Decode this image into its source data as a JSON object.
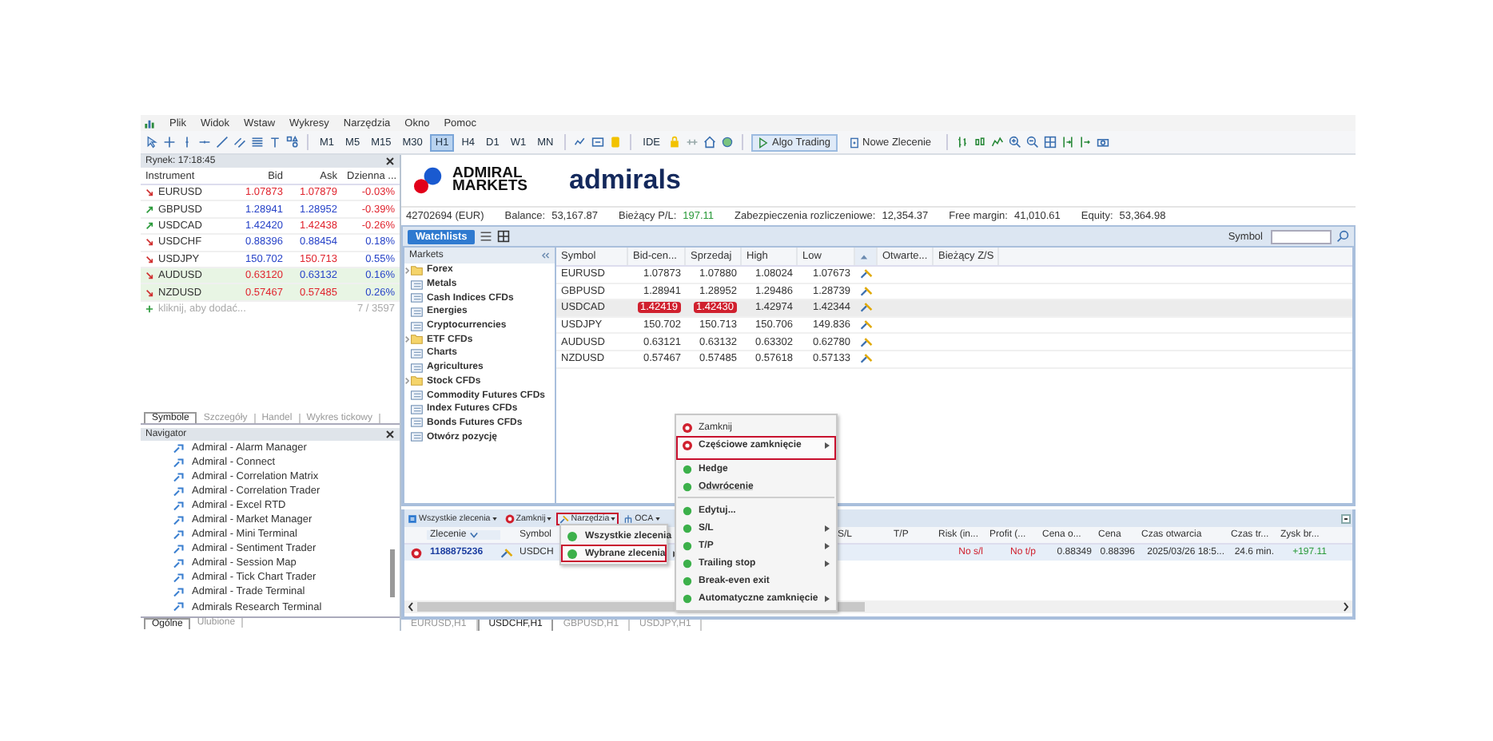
{
  "menu": [
    "Plik",
    "Widok",
    "Wstaw",
    "Wykresy",
    "Narzędzia",
    "Okno",
    "Pomoc"
  ],
  "toolbar": {
    "timeframes": [
      {
        "label": "M1",
        "selected": false
      },
      {
        "label": "M5",
        "selected": false
      },
      {
        "label": "M15",
        "selected": false
      },
      {
        "label": "M30",
        "selected": false
      },
      {
        "label": "H1",
        "selected": true
      },
      {
        "label": "H4",
        "selected": false
      },
      {
        "label": "D1",
        "selected": false
      },
      {
        "label": "W1",
        "selected": false
      },
      {
        "label": "MN",
        "selected": false
      }
    ],
    "ide": "IDE",
    "algo_trading": {
      "label": "Algo Trading",
      "on": true
    },
    "new_order": "Nowe Zlecenie"
  },
  "market_watch": {
    "title": "Rynek: 17:18:45",
    "columns": [
      "Instrument",
      "Bid",
      "Ask",
      "Dzienna ..."
    ],
    "rows": [
      {
        "symbol": "EURUSD",
        "trend_up": false,
        "bid": "1.07873",
        "bid_up": false,
        "ask": "1.07879",
        "ask_up": false,
        "change": "-0.03%",
        "change_up": false,
        "highlighted": false
      },
      {
        "symbol": "GBPUSD",
        "trend_up": true,
        "bid": "1.28941",
        "bid_up": true,
        "ask": "1.28952",
        "ask_up": true,
        "change": "-0.39%",
        "change_up": false,
        "highlighted": false
      },
      {
        "symbol": "USDCAD",
        "trend_up": true,
        "bid": "1.42420",
        "bid_up": true,
        "ask": "1.42438",
        "ask_up": false,
        "change": "-0.26%",
        "change_up": false,
        "highlighted": false
      },
      {
        "symbol": "USDCHF",
        "trend_up": false,
        "bid": "0.88396",
        "bid_up": true,
        "ask": "0.88454",
        "ask_up": true,
        "change": "0.18%",
        "change_up": true,
        "highlighted": false
      },
      {
        "symbol": "USDJPY",
        "trend_up": false,
        "bid": "150.702",
        "bid_up": true,
        "ask": "150.713",
        "ask_up": false,
        "change": "0.55%",
        "change_up": true,
        "highlighted": false
      },
      {
        "symbol": "AUDUSD",
        "trend_up": false,
        "bid": "0.63120",
        "bid_up": false,
        "ask": "0.63132",
        "ask_up": true,
        "change": "0.16%",
        "change_up": true,
        "highlighted": true
      },
      {
        "symbol": "NZDUSD",
        "trend_up": false,
        "bid": "0.57467",
        "bid_up": false,
        "ask": "0.57485",
        "ask_up": false,
        "change": "0.26%",
        "change_up": true,
        "highlighted": true
      }
    ],
    "add_hint": "kliknij, aby dodać...",
    "count": "7 / 3597",
    "tabs": [
      {
        "label": "Symbole",
        "selected": true
      },
      {
        "label": "Szczegóły",
        "selected": false
      },
      {
        "label": "Handel",
        "selected": false
      },
      {
        "label": "Wykres tickowy",
        "selected": false
      }
    ]
  },
  "navigator": {
    "title": "Navigator",
    "items": [
      "Admiral - Alarm Manager",
      "Admiral - Connect",
      "Admiral - Correlation Matrix",
      "Admiral - Correlation Trader",
      "Admiral - Excel RTD",
      "Admiral - Market Manager",
      "Admiral - Mini Terminal",
      "Admiral - Sentiment Trader",
      "Admiral - Session Map",
      "Admiral - Tick Chart Trader",
      "Admiral - Trade Terminal",
      "Admirals Research Terminal"
    ],
    "tabs": [
      {
        "label": "Ogólne",
        "selected": true
      },
      {
        "label": "Ulubione",
        "selected": false
      }
    ]
  },
  "logo": {
    "line1": "ADMIRAL",
    "line2": "MARKETS",
    "brand": "admirals"
  },
  "account": [
    {
      "label": "42702694 (EUR)"
    },
    {
      "label": "Balance:",
      "value": "53,167.87",
      "positive": false
    },
    {
      "label": "Bieżący P/L:",
      "value": "197.11",
      "positive": true
    },
    {
      "label": "Zabezpieczenia rozliczeniowe:",
      "value": "12,354.37",
      "positive": false
    },
    {
      "label": "Free margin:",
      "value": "41,010.61",
      "positive": false
    },
    {
      "label": "Equity:",
      "value": "53,364.98",
      "positive": false
    }
  ],
  "watchlist": {
    "button": "Watchlists",
    "search_label": "Symbol"
  },
  "markets": {
    "title": "Markets",
    "items": [
      {
        "label": "Forex",
        "kind": "folder"
      },
      {
        "label": "Metals",
        "kind": "list"
      },
      {
        "label": "Cash Indices CFDs",
        "kind": "list"
      },
      {
        "label": "Energies",
        "kind": "list"
      },
      {
        "label": "Cryptocurrencies",
        "kind": "list"
      },
      {
        "label": "ETF CFDs",
        "kind": "folder"
      },
      {
        "label": "Charts",
        "kind": "list"
      },
      {
        "label": "Agricultures",
        "kind": "list"
      },
      {
        "label": "Stock CFDs",
        "kind": "folder"
      },
      {
        "label": "Commodity Futures CFDs",
        "kind": "list"
      },
      {
        "label": "Index Futures CFDs",
        "kind": "list"
      },
      {
        "label": "Bonds Futures CFDs",
        "kind": "list"
      },
      {
        "label": "Otwórz pozycję",
        "kind": "list"
      }
    ]
  },
  "quotes": {
    "columns": [
      {
        "label": "Symbol",
        "sorted": false
      },
      {
        "label": "Bid-cen...",
        "sorted": false
      },
      {
        "label": "Sprzedaj",
        "sorted": false
      },
      {
        "label": "High",
        "sorted": false
      },
      {
        "label": "Low",
        "sorted": false
      },
      {
        "sorted": true
      },
      {
        "label": "Otwarte...",
        "sorted": false
      },
      {
        "label": "Bieżący Z/S",
        "sorted": false
      }
    ],
    "rows": [
      {
        "symbol": "EURUSD",
        "bid": "1.07873",
        "ask": "1.07880",
        "high": "1.08024",
        "low": "1.07673",
        "alert": false
      },
      {
        "symbol": "GBPUSD",
        "bid": "1.28941",
        "ask": "1.28952",
        "high": "1.29486",
        "low": "1.28739",
        "alert": false
      },
      {
        "symbol": "USDCAD",
        "bid": "1.42419",
        "ask": "1.42430",
        "high": "1.42974",
        "low": "1.42344",
        "alert": true
      },
      {
        "symbol": "USDJPY",
        "bid": "150.702",
        "ask": "150.713",
        "high": "150.706",
        "low": "149.836",
        "alert": false
      },
      {
        "symbol": "AUDUSD",
        "bid": "0.63121",
        "ask": "0.63132",
        "high": "0.63302",
        "low": "0.62780",
        "alert": false
      },
      {
        "symbol": "NZDUSD",
        "bid": "0.57467",
        "ask": "0.57485",
        "high": "0.57618",
        "low": "0.57133",
        "alert": false
      }
    ]
  },
  "trade": {
    "buttons": [
      {
        "label": "Wszystkie zlecenia",
        "kind": "list",
        "highlighted": false
      },
      {
        "label": "Zamknij",
        "kind": "close",
        "highlighted": false
      },
      {
        "label": "Narzędzia",
        "kind": "tools",
        "highlighted": true
      },
      {
        "label": "OCA",
        "kind": "oca",
        "highlighted": false
      }
    ],
    "columns": [
      {
        "label": "Zlecenie",
        "sorted": true
      },
      {
        "label": "Symbol",
        "sorted": false
      },
      {
        "label": "S/L",
        "sorted": false
      },
      {
        "label": "T/P",
        "sorted": false
      },
      {
        "label": "Risk (in...",
        "sorted": false
      },
      {
        "label": "Profit (...",
        "sorted": false
      },
      {
        "label": "Cena o...",
        "sorted": false
      },
      {
        "label": "Cena",
        "sorted": false
      },
      {
        "label": "Czas otwarcia",
        "sorted": false
      },
      {
        "label": "Czas tr...",
        "sorted": false
      },
      {
        "label": "Zysk br...",
        "sorted": false
      }
    ],
    "order": {
      "id": "1188875236",
      "symbol": "USDCH",
      "risk": "No s/l",
      "profit": "No t/p",
      "open_price": "0.88349",
      "price": "0.88396",
      "open_time": "2025/03/26 18:5...",
      "duration": "24.6 min.",
      "gross": "+197.11"
    }
  },
  "chart_tabs": [
    {
      "label": "EURUSD,H1",
      "selected": false
    },
    {
      "label": "USDCHF,H1",
      "selected": true
    },
    {
      "label": "GBPUSD,H1",
      "selected": false
    },
    {
      "label": "USDJPY,H1",
      "selected": false
    }
  ],
  "tools_menu": [
    {
      "label": "Wszystkie zlecenia",
      "highlighted": false
    },
    {
      "label": "Wybrane zlecenia",
      "highlighted": true
    }
  ],
  "context_menu": [
    {
      "label": "Zamknij",
      "kind": "close",
      "submenu": false,
      "highlighted": false,
      "separator_after": false
    },
    {
      "label": "Częściowe zamknięcie",
      "kind": "close",
      "submenu": true,
      "highlighted": true,
      "separator_after": true
    },
    {
      "label": "Hedge",
      "kind": "dot",
      "submenu": false,
      "highlighted": false,
      "separator_after": false
    },
    {
      "label": "Odwrócenie",
      "kind": "dot",
      "submenu": false,
      "highlighted": false,
      "separator_after": true
    },
    {
      "label": "Edytuj...",
      "kind": "dot",
      "submenu": false,
      "highlighted": false,
      "separator_after": false
    },
    {
      "label": "S/L",
      "kind": "dot",
      "submenu": true,
      "highlighted": false,
      "separator_after": false
    },
    {
      "label": "T/P",
      "kind": "dot",
      "submenu": true,
      "highlighted": false,
      "separator_after": false
    },
    {
      "label": "Trailing stop",
      "kind": "dot",
      "submenu": true,
      "highlighted": false,
      "separator_after": false
    },
    {
      "label": "Break-even exit",
      "kind": "dot",
      "submenu": false,
      "highlighted": false,
      "separator_after": false
    },
    {
      "label": "Automatyczne zamknięcie",
      "kind": "dot",
      "submenu": true,
      "highlighted": false,
      "separator_after": false
    }
  ]
}
